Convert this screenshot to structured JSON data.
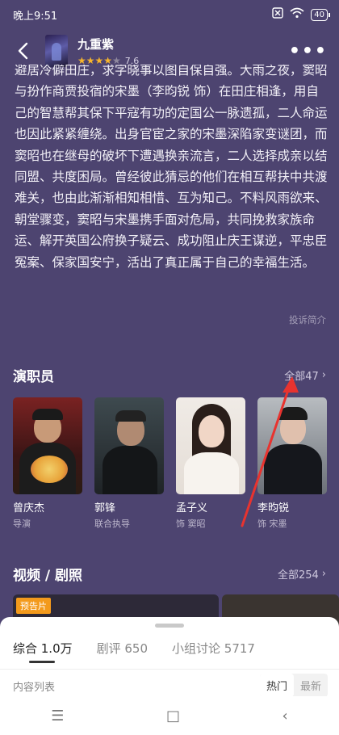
{
  "status": {
    "time": "晚上9:51",
    "battery": "40"
  },
  "header": {
    "title": "九重紫",
    "stars": 4,
    "rating": "7.6"
  },
  "synopsis": "避居冷僻田庄，求字晓事以图自保自强。大雨之夜，窦昭与扮作商贾投宿的宋墨（李昀锐 饰）在田庄相逢，用自己的智慧帮其保下平寇有功的定国公一脉遗孤，二人命运也因此紧紧缠绕。出身官宦之家的宋墨深陷家变谜团，而窦昭也在继母的破坏下遭遇换亲流言，二人选择成亲以结同盟、共度困局。曾经彼此猜忌的他们在相互帮扶中共渡难关，也由此渐渐相知相惜、互为知己。不料风雨欲来、朝堂骤变，窦昭与宋墨携手面对危局，共同挽救家族命运、解开英国公府换子疑云、成功阻止庆王谋逆，平忠臣冤案、保家国安宁，活出了真正属于自己的幸福生活。",
  "report_label": "投诉简介",
  "cast_section": {
    "title": "演职员",
    "all_label": "全部47",
    "members": [
      {
        "name": "曾庆杰",
        "role": "导演"
      },
      {
        "name": "郭锋",
        "role": "联合执导"
      },
      {
        "name": "孟子义",
        "role": "饰 窦昭"
      },
      {
        "name": "李昀锐",
        "role": "饰 宋墨"
      }
    ]
  },
  "media_section": {
    "title": "视频 / 剧照",
    "all_label": "全部254",
    "trailer_tag": "预告片"
  },
  "sheet": {
    "tabs": [
      "综合 1.0万",
      "剧评 650",
      "小组讨论 5717"
    ],
    "list_label": "内容列表",
    "sort_options": [
      "热门",
      "最新"
    ]
  },
  "system_nav": {
    "menu": "☰",
    "home": "□",
    "back": "‹"
  },
  "colors": {
    "background": "#4d4470",
    "star": "#f7b52c",
    "tag": "#f39a1c",
    "arrow": "#e8332f"
  }
}
